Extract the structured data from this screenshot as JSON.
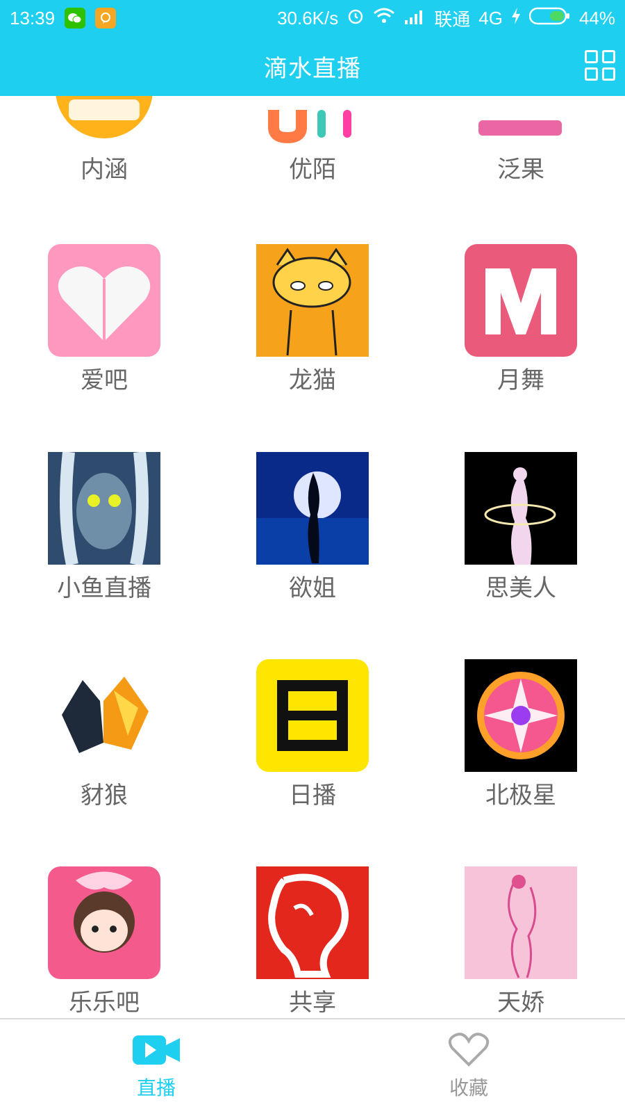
{
  "status_bar": {
    "time": "13:39",
    "speed": "30.6K/s",
    "carrier": "联通",
    "network": "4G",
    "battery": "44%",
    "icons": [
      "wechat-icon",
      "chat-icon",
      "alarm-icon",
      "wifi-icon",
      "signal-icon",
      "charging-icon",
      "battery-icon"
    ]
  },
  "header": {
    "title": "滴水直播",
    "grid_icon": "grid-icon"
  },
  "tiles": [
    {
      "label": "内涵",
      "icon": "neihan-icon"
    },
    {
      "label": "优陌",
      "icon": "youmo-icon"
    },
    {
      "label": "泛果",
      "icon": "fanguo-icon"
    },
    {
      "label": "爱吧",
      "icon": "aiba-icon"
    },
    {
      "label": "龙猫",
      "icon": "longmao-icon"
    },
    {
      "label": "月舞",
      "icon": "yuewu-icon"
    },
    {
      "label": "小鱼直播",
      "icon": "xiaoyu-icon"
    },
    {
      "label": "欲姐",
      "icon": "yujie-icon"
    },
    {
      "label": "思美人",
      "icon": "simeiren-icon"
    },
    {
      "label": "豺狼",
      "icon": "cailang-icon"
    },
    {
      "label": "日播",
      "icon": "ribo-icon"
    },
    {
      "label": "北极星",
      "icon": "beijixing-icon"
    },
    {
      "label": "乐乐吧",
      "icon": "leleba-icon"
    },
    {
      "label": "共享",
      "icon": "gongxiang-icon"
    },
    {
      "label": "天娇",
      "icon": "tianjiao-icon"
    }
  ],
  "bottom_nav": {
    "live_label": "直播",
    "fav_label": "收藏"
  },
  "colors": {
    "accent": "#1ecff0",
    "label_gray": "#666666",
    "inactive_gray": "#999999"
  }
}
